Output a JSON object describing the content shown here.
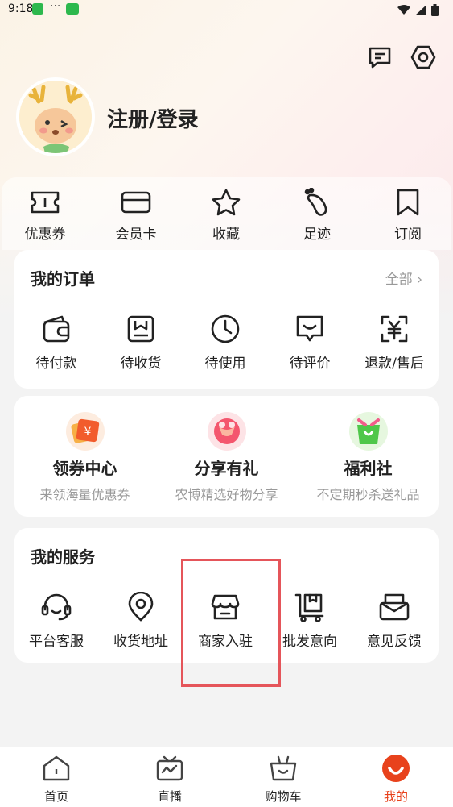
{
  "status_bar": {
    "time": "9:18",
    "dots": "···"
  },
  "header": {
    "login_label": "注册/登录"
  },
  "quick_links": [
    {
      "label": "优惠券",
      "icon": "ticket-icon"
    },
    {
      "label": "会员卡",
      "icon": "card-icon"
    },
    {
      "label": "收藏",
      "icon": "star-icon"
    },
    {
      "label": "足迹",
      "icon": "footprint-icon"
    },
    {
      "label": "订阅",
      "icon": "bookmark-icon"
    }
  ],
  "orders": {
    "title": "我的订单",
    "more": "全部 ›",
    "items": [
      {
        "label": "待付款",
        "icon": "wallet-icon"
      },
      {
        "label": "待收货",
        "icon": "package-icon"
      },
      {
        "label": "待使用",
        "icon": "clock-icon"
      },
      {
        "label": "待评价",
        "icon": "comment-icon"
      },
      {
        "label": "退款/售后",
        "icon": "refund-icon"
      }
    ]
  },
  "promos": [
    {
      "title": "领券中心",
      "subtitle": "来领海量优惠券",
      "icon": "coupon-center-icon"
    },
    {
      "title": "分享有礼",
      "subtitle": "农博精选好物分享",
      "icon": "gift-share-icon"
    },
    {
      "title": "福利社",
      "subtitle": "不定期秒杀送礼品",
      "icon": "welfare-bag-icon"
    }
  ],
  "services": {
    "title": "我的服务",
    "items": [
      {
        "label": "平台客服",
        "icon": "headset-icon"
      },
      {
        "label": "收货地址",
        "icon": "location-icon"
      },
      {
        "label": "商家入驻",
        "icon": "store-icon"
      },
      {
        "label": "批发意向",
        "icon": "wholesale-cart-icon"
      },
      {
        "label": "意见反馈",
        "icon": "feedback-mail-icon"
      }
    ]
  },
  "tabbar": [
    {
      "label": "首页",
      "icon": "home-icon",
      "active": false
    },
    {
      "label": "直播",
      "icon": "tv-icon",
      "active": false
    },
    {
      "label": "购物车",
      "icon": "basket-icon",
      "active": false
    },
    {
      "label": "我的",
      "icon": "profile-logo-icon",
      "active": true
    }
  ],
  "colors": {
    "accent": "#e8421c",
    "highlight_box": "#e5555a",
    "background": "#f3f3f3"
  }
}
